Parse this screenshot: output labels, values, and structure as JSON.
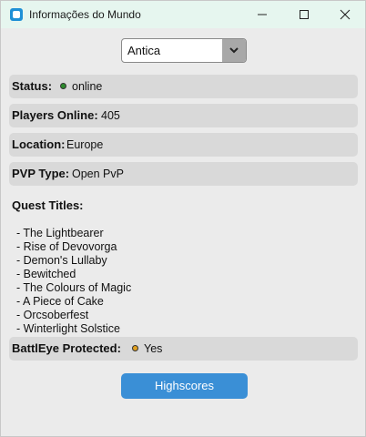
{
  "window": {
    "title": "Informações do Mundo"
  },
  "world_select": {
    "value": "Antica",
    "icon": "chevron-down-icon"
  },
  "status": {
    "label": "Status:",
    "value": "online",
    "indicator_color": "#2e8b2e"
  },
  "players_online": {
    "label": "Players Online:",
    "value": "405"
  },
  "location": {
    "label": "Location:",
    "value": "Europe"
  },
  "pvp_type": {
    "label": "PVP Type:",
    "value": "Open PvP"
  },
  "quests": {
    "title": "Quest Titles:",
    "items": [
      "- The Lightbearer",
      "- Rise of Devovorga",
      "- Demon's Lullaby",
      "- Bewitched",
      "- The Colours of Magic",
      "- A Piece of Cake",
      "- Orcsoberfest",
      "- Winterlight Solstice"
    ]
  },
  "battleye": {
    "label": "BattlEye Protected:",
    "value": "Yes",
    "indicator_color": "#e0a020"
  },
  "actions": {
    "highscores_label": "Highscores"
  },
  "colors": {
    "titlebar": "#e6f6ef",
    "accent": "#3a8fd6",
    "row_background": "#d9d9d9"
  }
}
